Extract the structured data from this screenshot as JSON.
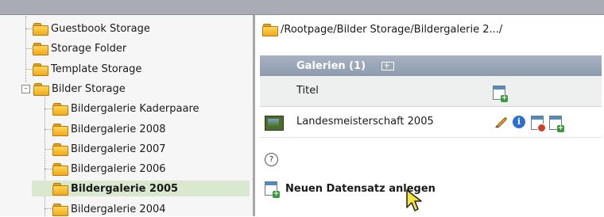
{
  "tree": {
    "items": [
      {
        "label": "Guestbook Storage"
      },
      {
        "label": "Storage Folder"
      },
      {
        "label": "Template Storage"
      },
      {
        "label": "Bilder Storage"
      },
      {
        "label": "Bildergalerie Kaderpaare"
      },
      {
        "label": "Bildergalerie 2008"
      },
      {
        "label": "Bildergalerie 2007"
      },
      {
        "label": "Bildergalerie 2006"
      },
      {
        "label": "Bildergalerie 2005"
      },
      {
        "label": "Bildergalerie 2004"
      }
    ],
    "expander_symbol": "–",
    "selected": "Bildergalerie 2005"
  },
  "main": {
    "path": "/Rootpage/Bilder Storage/Bildergalerie 2.../",
    "galerien_header": "Galerien (1)",
    "column_titel": "Titel",
    "record_title": "Landesmeisterschaft 2005",
    "help_symbol": "?",
    "new_record_label": "Neuen Datensatz anlegen"
  },
  "icons": {
    "info_glyph": "i",
    "plus_glyph": "+"
  },
  "colors": {
    "header_bg": "#9aa6b8",
    "selected_bg": "#d9e8cf",
    "folder": "#f2a919"
  }
}
